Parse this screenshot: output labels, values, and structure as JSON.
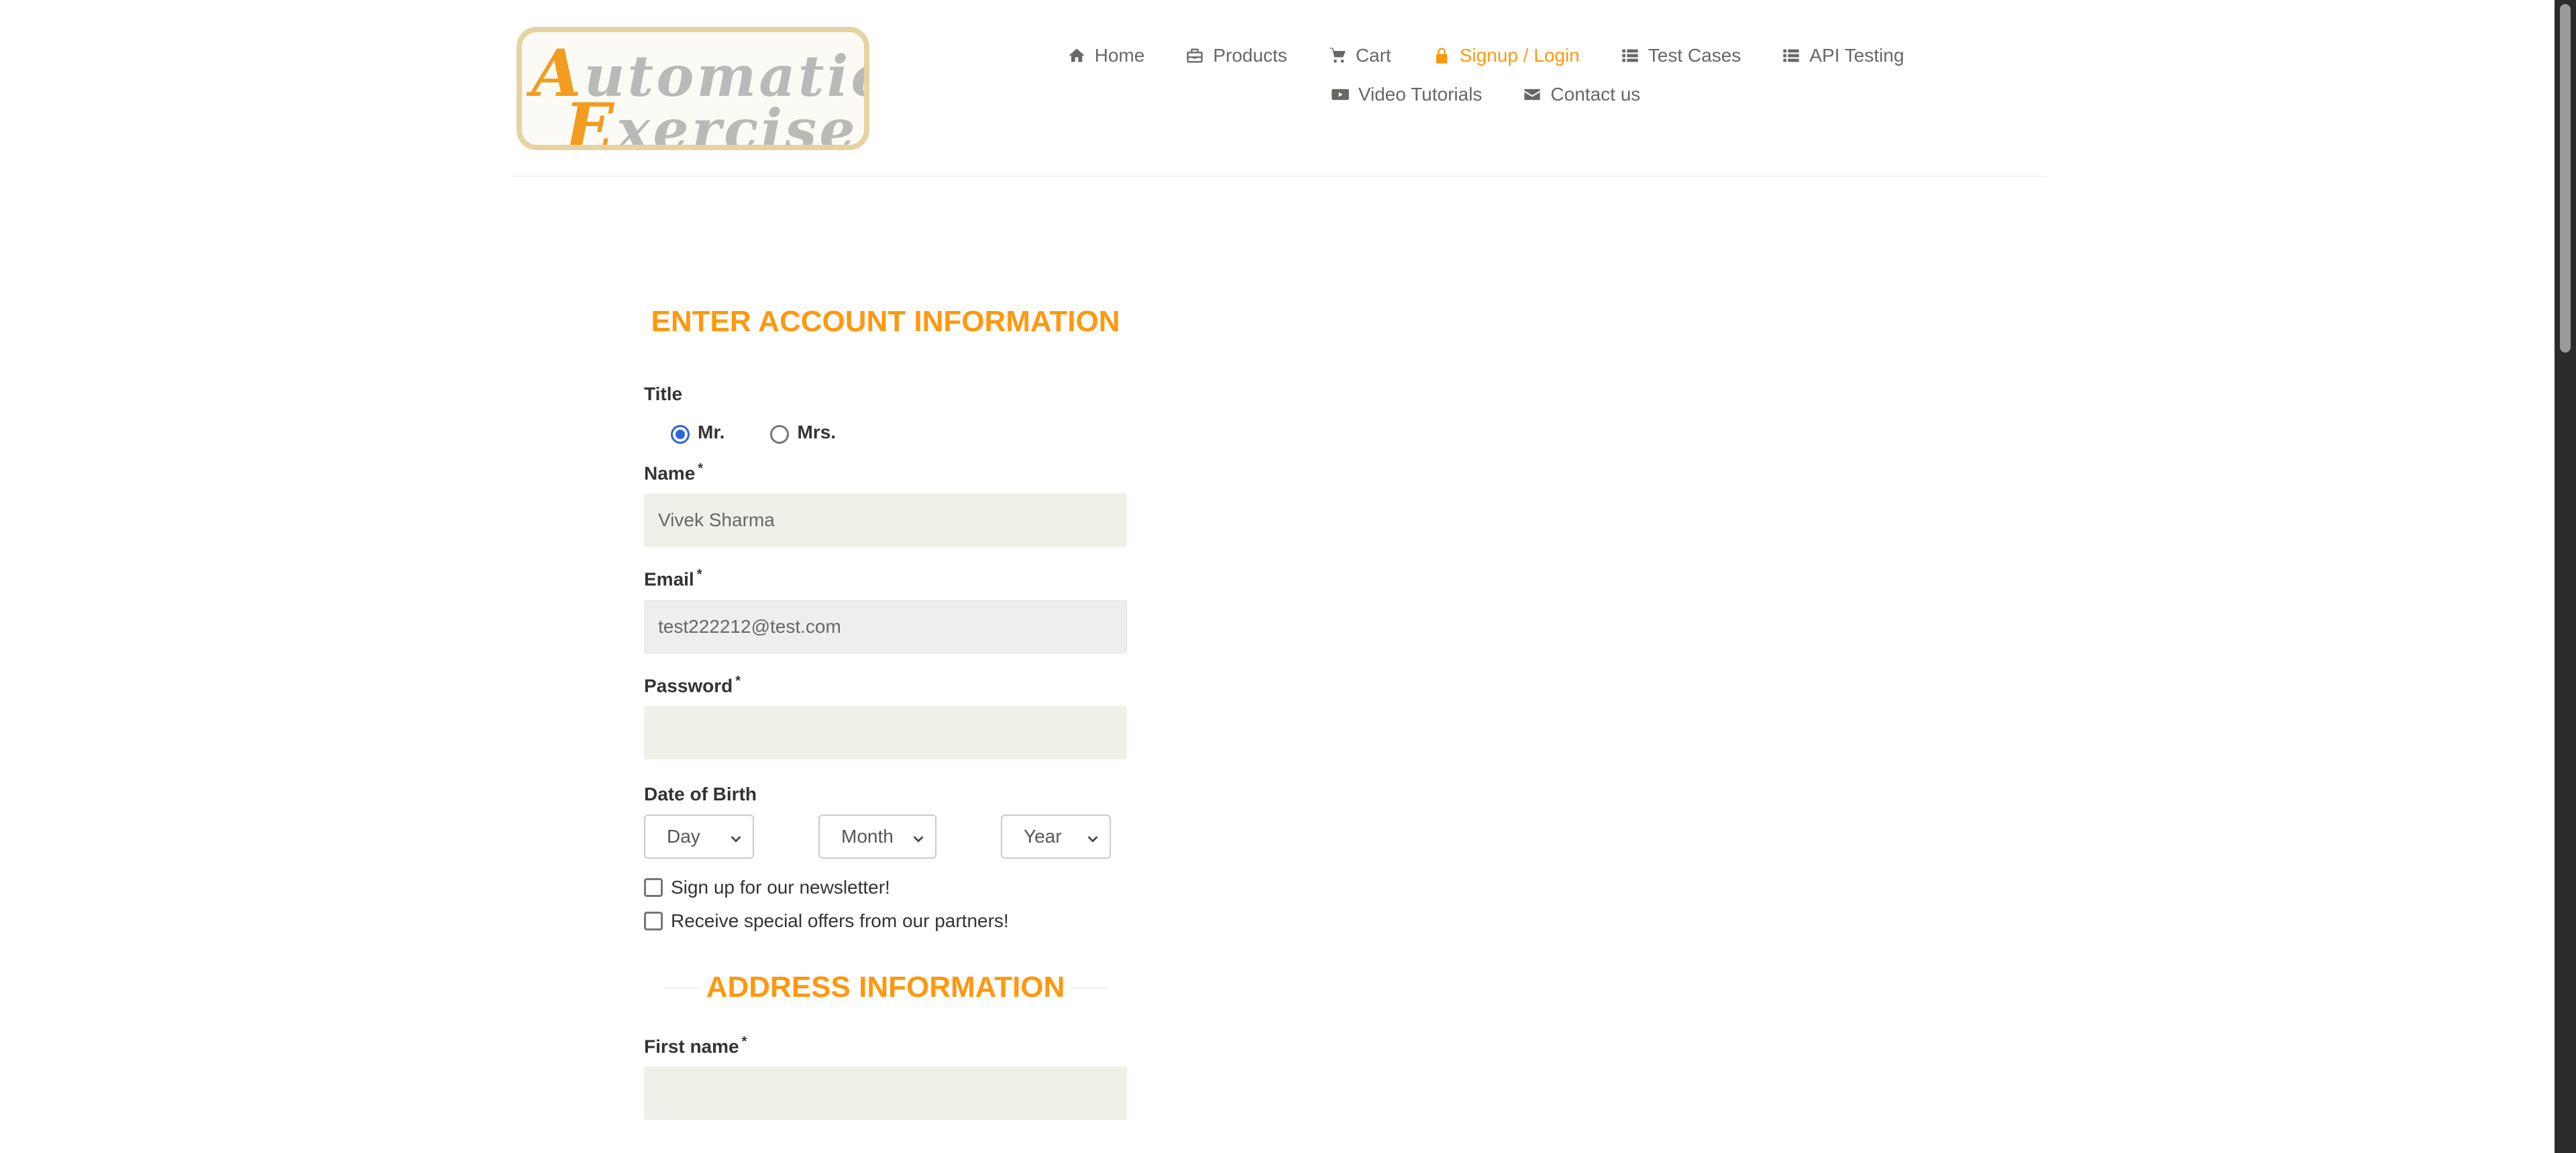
{
  "logo": {
    "line1_cap": "A",
    "line1_rest": "utomation",
    "line2_cap": "E",
    "line2_rest": "xercise"
  },
  "nav": {
    "row1": [
      {
        "label": "Home",
        "icon": "home-icon",
        "active": false
      },
      {
        "label": "Products",
        "icon": "briefcase-icon",
        "active": false
      },
      {
        "label": "Cart",
        "icon": "cart-icon",
        "active": false
      },
      {
        "label": "Signup / Login",
        "icon": "lock-icon",
        "active": true
      },
      {
        "label": "Test Cases",
        "icon": "list-icon",
        "active": false
      },
      {
        "label": "API Testing",
        "icon": "list-icon",
        "active": false
      }
    ],
    "row2": [
      {
        "label": "Video Tutorials",
        "icon": "youtube-icon",
        "active": false
      },
      {
        "label": "Contact us",
        "icon": "envelope-icon",
        "active": false
      }
    ]
  },
  "account_section": {
    "heading": "Enter Account Information",
    "title_label": "Title",
    "title_options": [
      {
        "label": "Mr.",
        "checked": true
      },
      {
        "label": "Mrs.",
        "checked": false
      }
    ],
    "name_label": "Name",
    "name_value": "Vivek Sharma",
    "email_label": "Email",
    "email_value": "test222212@test.com",
    "password_label": "Password",
    "password_value": "",
    "required_mark": "*",
    "dob_label": "Date of Birth",
    "dob_day": "Day",
    "dob_month": "Month",
    "dob_year": "Year",
    "newsletter_label": "Sign up for our newsletter!",
    "newsletter_checked": false,
    "offers_label": "Receive special offers from our partners!",
    "offers_checked": false
  },
  "address_section": {
    "heading": "Address Information",
    "first_name_label": "First name",
    "first_name_value": ""
  },
  "colors": {
    "accent": "#fe980f",
    "nav_text": "#696763",
    "input_bg": "#f0f0e9",
    "radio_checked": "#2e63d8"
  }
}
